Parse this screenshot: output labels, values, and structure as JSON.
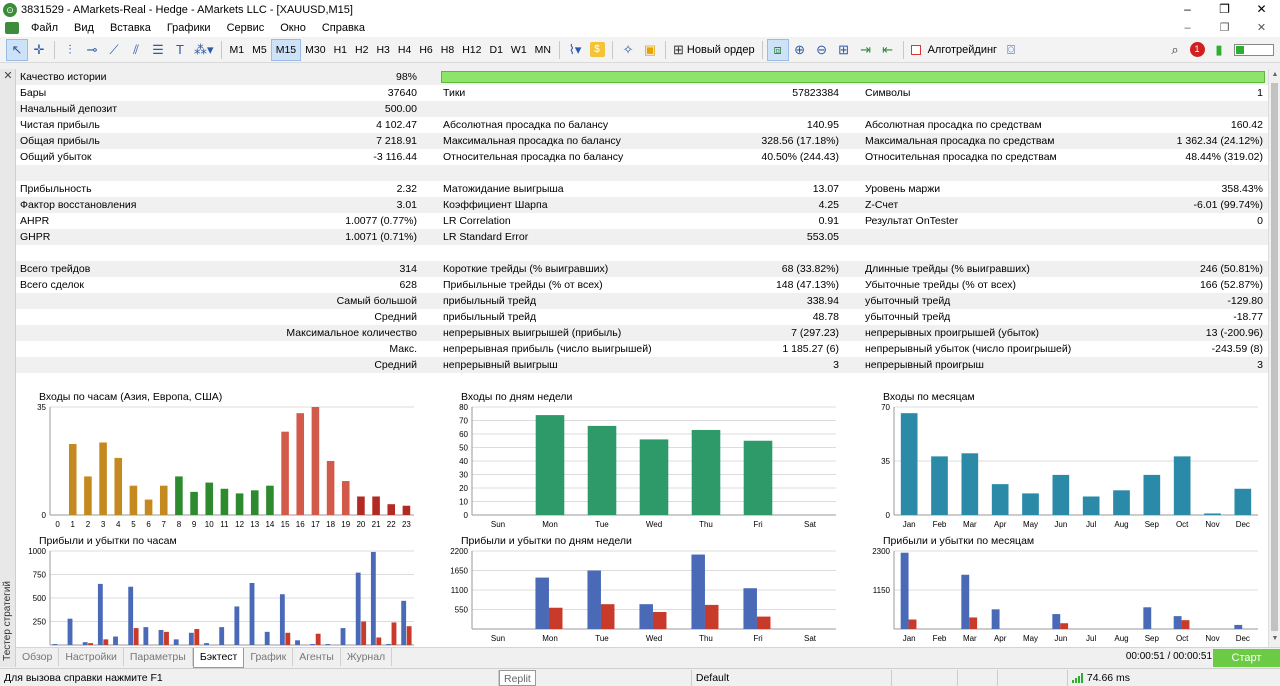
{
  "window": {
    "title": "3831529 - AMarkets-Real - Hedge - AMarkets LLC - [XAUUSD,M15]",
    "minimize": "–",
    "maximize": "❐",
    "close": "✕",
    "child_min": "–",
    "child_restore": "❐",
    "child_close": "✕"
  },
  "menu": [
    "Файл",
    "Вид",
    "Вставка",
    "Графики",
    "Сервис",
    "Окно",
    "Справка"
  ],
  "toolbar": {
    "timeframes": [
      "M1",
      "M5",
      "M15",
      "M30",
      "H1",
      "H2",
      "H3",
      "H4",
      "H6",
      "H8",
      "H12",
      "D1",
      "W1",
      "MN"
    ],
    "active_timeframe": "M15",
    "new_order": "Новый ордер",
    "algotrading": "Алготрейдинг",
    "notification_count": "1"
  },
  "side_panel": {
    "close": "✕",
    "title": "Тестер стратегий"
  },
  "report": {
    "rows": [
      {
        "c1l": "Качество истории",
        "c1v": "98%",
        "c2l": "",
        "c2v": "",
        "c3l": "",
        "c3v": "",
        "shade": true,
        "quality": true
      },
      {
        "c1l": "Бары",
        "c1v": "37640",
        "c2l": "Тики",
        "c2v": "57823384",
        "c3l": "Символы",
        "c3v": "1",
        "shade": false
      },
      {
        "c1l": "Начальный депозит",
        "c1v": "500.00",
        "c2l": "",
        "c2v": "",
        "c3l": "",
        "c3v": "",
        "shade": true
      },
      {
        "c1l": "Чистая прибыль",
        "c1v": "4 102.47",
        "c2l": "Абсолютная просадка по балансу",
        "c2v": "140.95",
        "c3l": "Абсолютная просадка по средствам",
        "c3v": "160.42",
        "shade": false
      },
      {
        "c1l": "Общая прибыль",
        "c1v": "7 218.91",
        "c2l": "Максимальная просадка по балансу",
        "c2v": "328.56 (17.18%)",
        "c3l": "Максимальная просадка по средствам",
        "c3v": "1 362.34 (24.12%)",
        "shade": true
      },
      {
        "c1l": "Общий убыток",
        "c1v": "-3 116.44",
        "c2l": "Относительная просадка по балансу",
        "c2v": "40.50% (244.43)",
        "c3l": "Относительная просадка по средствам",
        "c3v": "48.44% (319.02)",
        "shade": false
      },
      {
        "c1l": "",
        "c1v": "",
        "c2l": "",
        "c2v": "",
        "c3l": "",
        "c3v": "",
        "shade": true
      },
      {
        "c1l": "Прибыльность",
        "c1v": "2.32",
        "c2l": "Матожидание выигрыша",
        "c2v": "13.07",
        "c3l": "Уровень маржи",
        "c3v": "358.43%",
        "shade": false
      },
      {
        "c1l": "Фактор восстановления",
        "c1v": "3.01",
        "c2l": "Коэффициент Шарпа",
        "c2v": "4.25",
        "c3l": "Z-Счет",
        "c3v": "-6.01 (99.74%)",
        "shade": true
      },
      {
        "c1l": "AHPR",
        "c1v": "1.0077 (0.77%)",
        "c2l": "LR Correlation",
        "c2v": "0.91",
        "c3l": "Результат OnTester",
        "c3v": "0",
        "shade": false
      },
      {
        "c1l": "GHPR",
        "c1v": "1.0071 (0.71%)",
        "c2l": "LR Standard Error",
        "c2v": "553.05",
        "c3l": "",
        "c3v": "",
        "shade": true
      },
      {
        "c1l": "",
        "c1v": "",
        "c2l": "",
        "c2v": "",
        "c3l": "",
        "c3v": "",
        "shade": false
      },
      {
        "c1l": "Всего трейдов",
        "c1v": "314",
        "c2l": "Короткие трейды (% выигравших)",
        "c2v": "68 (33.82%)",
        "c3l": "Длинные трейды (% выигравших)",
        "c3v": "246 (50.81%)",
        "shade": true
      },
      {
        "c1l": "Всего сделок",
        "c1v": "628",
        "c2l": "Прибыльные трейды (% от всех)",
        "c2v": "148 (47.13%)",
        "c3l": "Убыточные трейды (% от всех)",
        "c3v": "166 (52.87%)",
        "shade": false
      },
      {
        "c1l": "",
        "c1v": "Самый большой",
        "c2l": "прибыльный трейд",
        "c2v": "338.94",
        "c3l": "убыточный трейд",
        "c3v": "-129.80",
        "shade": true
      },
      {
        "c1l": "",
        "c1v": "Средний",
        "c2l": "прибыльный трейд",
        "c2v": "48.78",
        "c3l": "убыточный трейд",
        "c3v": "-18.77",
        "shade": false
      },
      {
        "c1l": "",
        "c1v": "Максимальное количество",
        "c2l": "непрерывных выигрышей (прибыль)",
        "c2v": "7 (297.23)",
        "c3l": "непрерывных проигрышей (убыток)",
        "c3v": "13 (-200.96)",
        "shade": true
      },
      {
        "c1l": "",
        "c1v": "Макс.",
        "c2l": "непрерывная прибыль (число выигрышей)",
        "c2v": "1 185.27 (6)",
        "c3l": "непрерывный убыток (число проигрышей)",
        "c3v": "-243.59 (8)",
        "shade": false
      },
      {
        "c1l": "",
        "c1v": "Средний",
        "c2l": "непрерывный выигрыш",
        "c2v": "3",
        "c3l": "непрерывный проигрыш",
        "c3v": "3",
        "shade": true
      },
      {
        "c1l": "",
        "c1v": "",
        "c2l": "",
        "c2v": "",
        "c3l": "",
        "c3v": "",
        "shade": false
      }
    ]
  },
  "chart_data": [
    {
      "type": "bar",
      "title": "Входы по часам (Азия, Европа, США)",
      "categories": [
        "0",
        "1",
        "2",
        "3",
        "4",
        "5",
        "6",
        "7",
        "8",
        "9",
        "10",
        "11",
        "12",
        "13",
        "14",
        "15",
        "16",
        "17",
        "18",
        "19",
        "20",
        "21",
        "22",
        "23"
      ],
      "values": [
        0,
        23,
        12.5,
        23.5,
        18.5,
        9.5,
        5,
        9.5,
        12.5,
        7.5,
        10.5,
        8.5,
        7,
        8,
        9.5,
        27,
        33,
        35,
        17.5,
        11,
        6,
        6,
        3.5,
        3
      ],
      "colors": [
        "#c48a20",
        "#c48a20",
        "#c48a20",
        "#c48a20",
        "#c48a20",
        "#c48a20",
        "#c48a20",
        "#c48a20",
        "#2e8a2e",
        "#2e8a2e",
        "#2e8a2e",
        "#2e8a2e",
        "#2e8a2e",
        "#2e8a2e",
        "#2e8a2e",
        "#d25a4a",
        "#d25a4a",
        "#d25a4a",
        "#d25a4a",
        "#d25a4a",
        "#b22a22",
        "#b22a22",
        "#b22a22",
        "#b22a22"
      ],
      "ylim": [
        0,
        35
      ],
      "yticks": [
        "0",
        "35"
      ]
    },
    {
      "type": "bar",
      "title": "Входы по дням недели",
      "categories": [
        "Sun",
        "Mon",
        "Tue",
        "Wed",
        "Thu",
        "Fri",
        "Sat"
      ],
      "values": [
        0,
        74,
        66,
        56,
        63,
        55,
        0
      ],
      "color": "#2e9a6a",
      "ylim": [
        0,
        80
      ],
      "yticks": [
        "0",
        "10",
        "20",
        "30",
        "40",
        "50",
        "60",
        "70",
        "80"
      ]
    },
    {
      "type": "bar",
      "title": "Входы по месяцам",
      "categories": [
        "Jan",
        "Feb",
        "Mar",
        "Apr",
        "May",
        "Jun",
        "Jul",
        "Aug",
        "Sep",
        "Oct",
        "Nov",
        "Dec"
      ],
      "values": [
        66,
        38,
        40,
        20,
        14,
        26,
        12,
        16,
        26,
        38,
        1,
        17
      ],
      "color": "#2a8aa8",
      "ylim": [
        0,
        70
      ],
      "yticks": [
        "0",
        "35",
        "70"
      ]
    },
    {
      "type": "bar",
      "title": "Прибыли и убытки по часам",
      "ylim": [
        0,
        1000
      ],
      "yticks": [
        "250",
        "500",
        "750",
        "1000"
      ],
      "series": [
        {
          "values": [
            10,
            280,
            30,
            650,
            90,
            620,
            190,
            160,
            60,
            130,
            20,
            190,
            410,
            660,
            140,
            540,
            50,
            10,
            10,
            180,
            770,
            990,
            10,
            470
          ],
          "color": "#4a6ab8"
        },
        {
          "values": [
            0,
            0,
            0,
            0,
            40,
            0,
            0,
            0,
            150,
            0,
            0,
            0,
            190,
            0,
            0,
            0,
            0,
            0,
            0,
            0,
            0,
            0,
            0,
            0
          ],
          "color": "#c83a2a"
        },
        {
          "values": [
            0,
            0,
            0,
            0,
            0,
            0,
            0,
            0,
            0,
            0,
            0,
            0,
            0,
            0,
            0,
            0,
            0,
            0,
            0,
            0,
            0,
            0,
            0,
            0
          ],
          "color": "#c83a2a"
        }
      ],
      "pl_hours": {
        "profit": [
          10,
          280,
          30,
          650,
          90,
          620,
          190,
          160,
          60,
          130,
          20,
          190,
          410,
          660,
          140,
          540,
          50,
          10,
          10,
          180,
          770,
          990,
          10,
          470
        ],
        "loss": [
          0,
          0,
          20,
          60,
          0,
          180,
          0,
          140,
          0,
          170,
          0,
          0,
          0,
          0,
          0,
          130,
          0,
          120,
          0,
          0,
          250,
          80,
          240,
          200
        ]
      }
    },
    {
      "type": "bar",
      "title": "Прибыли и убытки по дням недели",
      "categories": [
        "Sun",
        "Mon",
        "Tue",
        "Wed",
        "Thu",
        "Fri",
        "Sat"
      ],
      "ylim": [
        0,
        2200
      ],
      "yticks": [
        "550",
        "1100",
        "1650",
        "2200"
      ],
      "series": [
        {
          "values": [
            0,
            1450,
            1650,
            700,
            2100,
            1150,
            0
          ],
          "color": "#4a6ab8"
        },
        {
          "values": [
            0,
            600,
            700,
            480,
            680,
            350,
            0
          ],
          "color": "#c83a2a"
        }
      ]
    },
    {
      "type": "bar",
      "title": "Прибыли и убытки по месяцам",
      "categories": [
        "Jan",
        "Feb",
        "Mar",
        "Apr",
        "May",
        "Jun",
        "Jul",
        "Aug",
        "Sep",
        "Oct",
        "Nov",
        "Dec"
      ],
      "ylim": [
        0,
        2300
      ],
      "yticks": [
        "1150",
        "2300"
      ],
      "series": [
        {
          "values": [
            2250,
            0,
            1600,
            580,
            0,
            440,
            0,
            0,
            640,
            380,
            0,
            120
          ],
          "color": "#4a6ab8"
        },
        {
          "values": [
            280,
            0,
            340,
            0,
            0,
            170,
            0,
            0,
            0,
            260,
            0,
            0
          ],
          "color": "#c83a2a"
        }
      ]
    }
  ],
  "bottom_tabs": [
    "Обзор",
    "Настройки",
    "Параметры",
    "Бэктест",
    "График",
    "Агенты",
    "Журнал"
  ],
  "active_tab": "Бэктест",
  "timer": "00:00:51 / 00:00:51",
  "start_button": "Старт",
  "status": {
    "help": "Для вызова справки нажмите F1",
    "replit": "Replit",
    "profile": "Default",
    "ping": "74.66 ms"
  }
}
